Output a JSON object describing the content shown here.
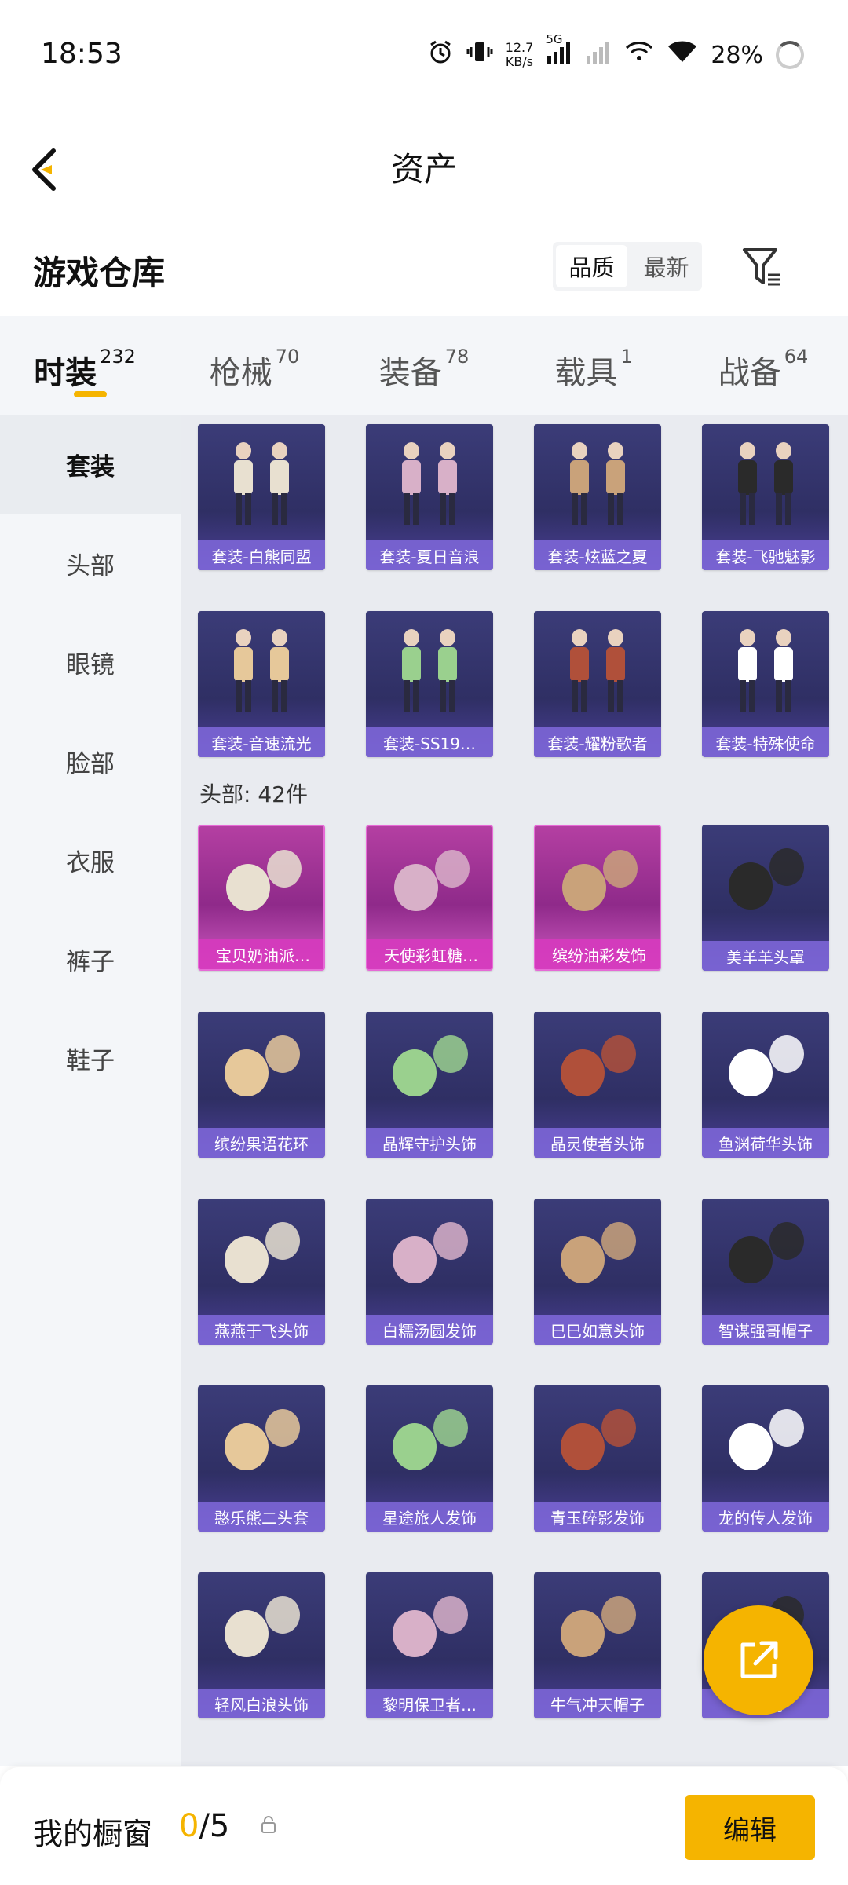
{
  "status_bar": {
    "time": "18:53",
    "net_speed_value": "12.7",
    "net_speed_unit": "KB/s",
    "network": "5G",
    "battery": "28%"
  },
  "header": {
    "title": "资产"
  },
  "warehouse": {
    "title": "游戏仓库",
    "sort_options": [
      "品质",
      "最新"
    ],
    "active_sort": "品质"
  },
  "categories": [
    {
      "label": "时装",
      "count": "232"
    },
    {
      "label": "枪械",
      "count": "70"
    },
    {
      "label": "装备",
      "count": "78"
    },
    {
      "label": "载具",
      "count": "1"
    },
    {
      "label": "战备",
      "count": "64"
    }
  ],
  "sidebar": {
    "items": [
      "套装",
      "头部",
      "眼镜",
      "脸部",
      "衣服",
      "裤子",
      "鞋子"
    ],
    "active": "套装"
  },
  "sets": [
    {
      "name": "套装-白熊同盟"
    },
    {
      "name": "套装-夏日音浪"
    },
    {
      "name": "套装-炫蓝之夏"
    },
    {
      "name": "套装-飞驰魅影"
    },
    {
      "name": "套装-音速流光"
    },
    {
      "name": "套装-SS19…"
    },
    {
      "name": "套装-耀粉歌者"
    },
    {
      "name": "套装-特殊使命"
    }
  ],
  "head_section": {
    "label": "头部: 42件"
  },
  "head_items": [
    {
      "name": "宝贝奶油派…",
      "rarity": "pink"
    },
    {
      "name": "天使彩虹糖…",
      "rarity": "pink"
    },
    {
      "name": "缤纷油彩发饰",
      "rarity": "pink"
    },
    {
      "name": "美羊羊头罩",
      "rarity": "purple"
    },
    {
      "name": "缤纷果语花环",
      "rarity": "purple"
    },
    {
      "name": "晶辉守护头饰",
      "rarity": "purple"
    },
    {
      "name": "晶灵使者头饰",
      "rarity": "purple"
    },
    {
      "name": "鱼渊荷华头饰",
      "rarity": "purple"
    },
    {
      "name": "燕燕于飞头饰",
      "rarity": "purple"
    },
    {
      "name": "白糯汤圆发饰",
      "rarity": "purple"
    },
    {
      "name": "巳巳如意头饰",
      "rarity": "purple"
    },
    {
      "name": "智谋强哥帽子",
      "rarity": "purple"
    },
    {
      "name": "憨乐熊二头套",
      "rarity": "purple"
    },
    {
      "name": "星途旅人发饰",
      "rarity": "purple"
    },
    {
      "name": "青玉碎影发饰",
      "rarity": "purple"
    },
    {
      "name": "龙的传人发饰",
      "rarity": "purple"
    },
    {
      "name": "轻风白浪头饰",
      "rarity": "purple"
    },
    {
      "name": "黎明保卫者…",
      "rarity": "purple"
    },
    {
      "name": "牛气冲天帽子",
      "rarity": "purple"
    },
    {
      "name": "…帽子",
      "rarity": "purple"
    }
  ],
  "bottom_bar": {
    "label": "我的橱窗",
    "current": "0",
    "total": "/5",
    "edit_label": "编辑"
  },
  "colors": {
    "accent": "#f5b400",
    "card_purple": "#3b3c78",
    "card_pink": "#b43fa2"
  },
  "icons": {
    "back": "chevron-left-icon",
    "filter": "filter-icon",
    "share": "share-icon",
    "lock": "lock-icon"
  }
}
